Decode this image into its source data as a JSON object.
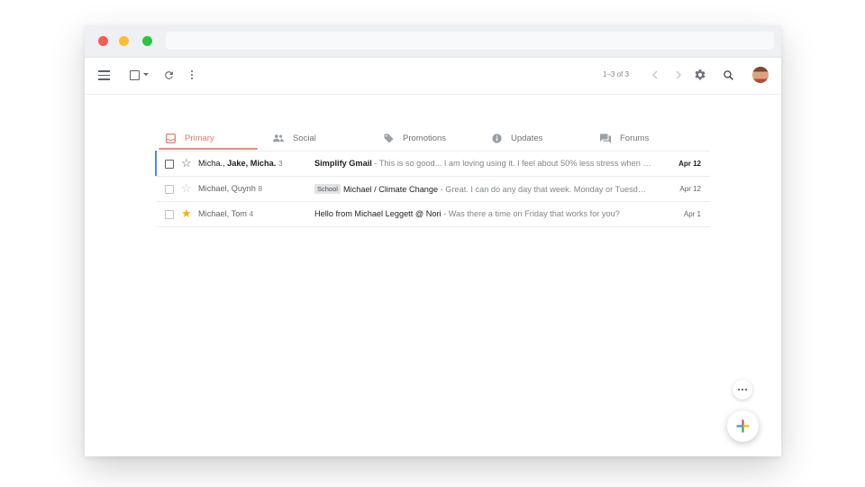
{
  "window": {
    "title_bar": ""
  },
  "toolbar": {
    "icons": [
      "menu-icon",
      "checkbox-icon",
      "refresh-icon",
      "more-vert-icon",
      "chevron-left-icon",
      "chevron-right-icon",
      "gear-icon",
      "search-icon"
    ],
    "pager_text": "1–3 of 3"
  },
  "tabs": [
    {
      "label": "Primary",
      "icon": "inbox-icon",
      "active": true
    },
    {
      "label": "Social",
      "icon": "people-icon",
      "active": false
    },
    {
      "label": "Promotions",
      "icon": "tag-icon",
      "active": false
    },
    {
      "label": "Updates",
      "icon": "info-icon",
      "active": false
    },
    {
      "label": "Forums",
      "icon": "forum-icon",
      "active": false
    }
  ],
  "emails": [
    {
      "sender_a": "Micha., ",
      "sender_b": "Jake, Micha.",
      "count": "3",
      "label": "",
      "subject": "Simplify Gmail",
      "snippet": " - This is so good... I am loving using it. I feel about 50% less stress when …",
      "date": "Apr 12",
      "unread": true,
      "starred": false,
      "selected": true
    },
    {
      "sender_a": "Michael, Quynh",
      "sender_b": "",
      "count": "8",
      "label": "School",
      "subject": "Michael / Climate Change",
      "snippet": " - Great. I can do any day that week. Monday or Tuesd…",
      "date": "Apr 12",
      "unread": false,
      "starred": false,
      "selected": false
    },
    {
      "sender_a": "Michael, Tom",
      "sender_b": "",
      "count": "4",
      "label": "",
      "subject": "Hello from Michael Leggett @ Nori",
      "snippet": " - Was there a time on Friday that works for you?",
      "date": "Apr 1",
      "unread": false,
      "starred": true,
      "selected": false
    }
  ],
  "colors": {
    "accent_active_tab": "#e8776b",
    "selection_bar": "#4a8ae8",
    "star_yellow": "#f4b400",
    "traffic_red": "#fc5a53",
    "traffic_yellow": "#fdbd2e",
    "traffic_green": "#27c840"
  },
  "fab": {
    "icon": "compose-plus-icon",
    "secondary_icon": "more-horiz-icon"
  }
}
